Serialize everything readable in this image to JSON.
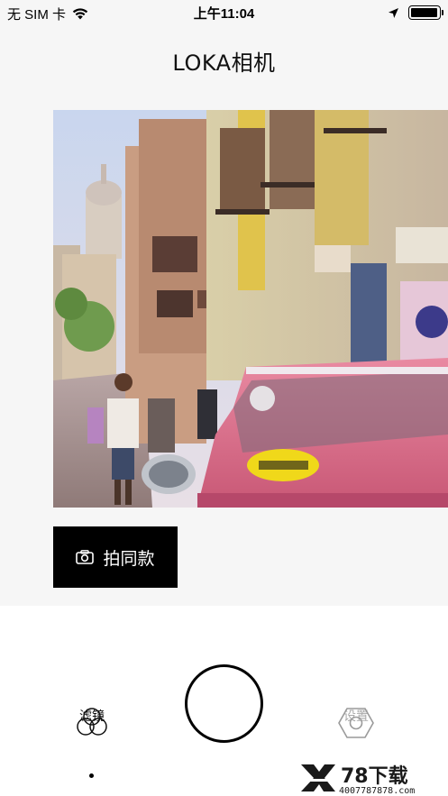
{
  "status_bar": {
    "carrier": "无 SIM 卡",
    "time": "上午11:04",
    "battery_level": 0.95
  },
  "header": {
    "title": "LOKA相机"
  },
  "action": {
    "same_style_label": "拍同款"
  },
  "bottom_tabs": [
    {
      "label": "滤镜",
      "active": true
    },
    {
      "label": "拍照",
      "active": false
    },
    {
      "label": "设置",
      "active": false
    }
  ],
  "watermark": {
    "brand": "78下载",
    "phone": "4007787878.com"
  },
  "colors": {
    "button_bg": "#000000",
    "page_bg": "#f6f6f6",
    "panel_bg": "#ffffff"
  }
}
